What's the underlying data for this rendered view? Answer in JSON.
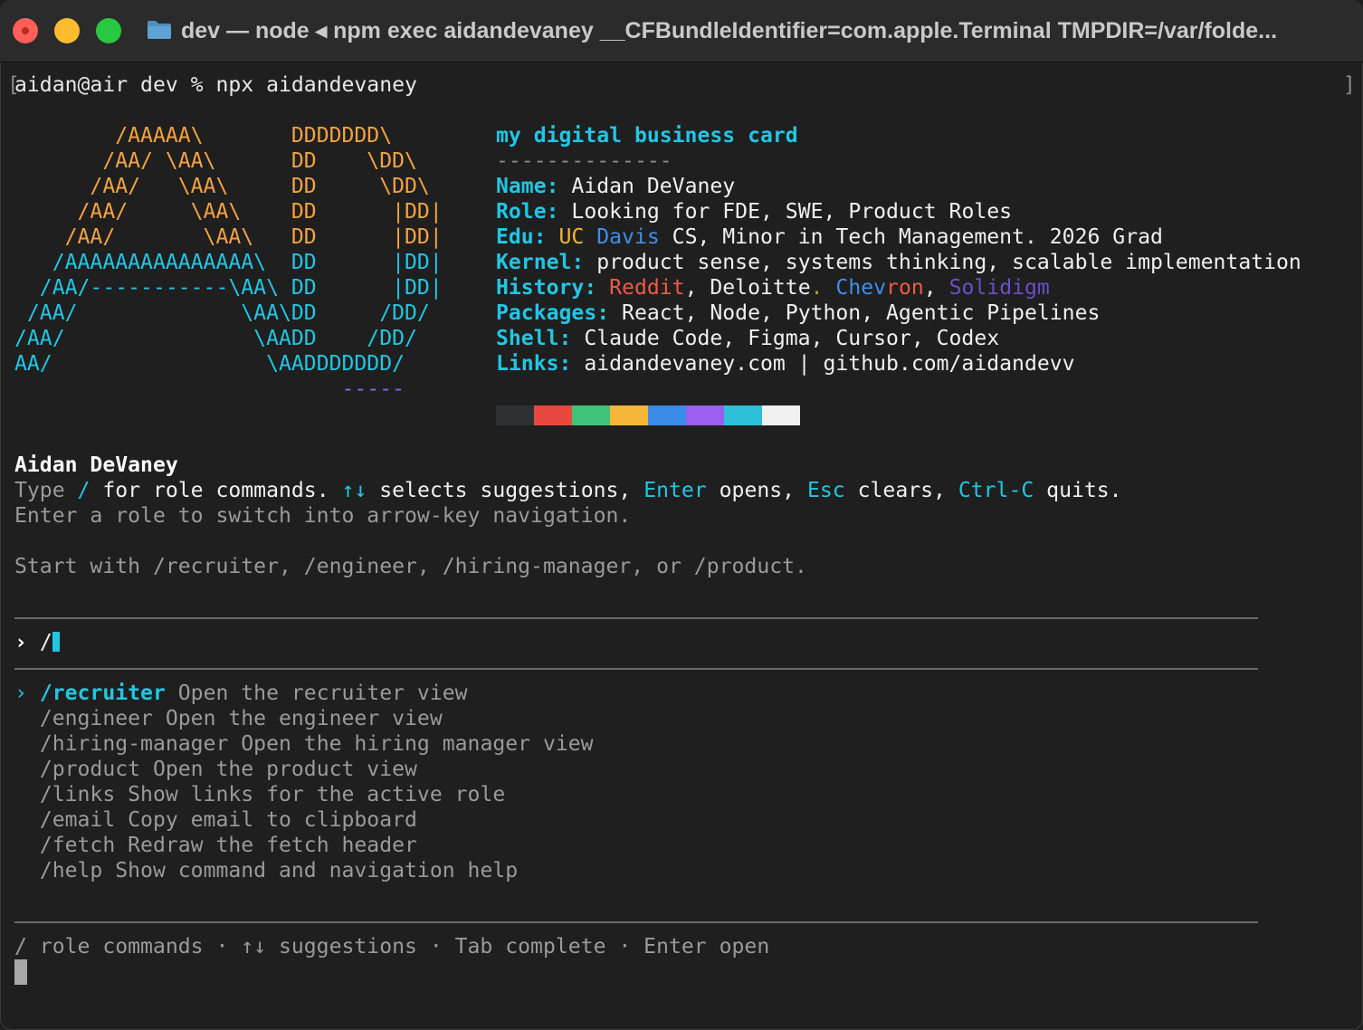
{
  "window": {
    "title": "dev — node ◂ npm exec aidandevaney __CFBundleIdentifier=com.apple.Terminal TMPDIR=/var/folde..."
  },
  "command_line": {
    "prompt": "aidan@air dev % ",
    "command": "npx aidandevaney",
    "bracket_left": "[",
    "bracket_right": "]"
  },
  "ascii_art": {
    "rows": [
      {
        "a": "        /AAAAA\\       ",
        "d": "DDDDDDD\\"
      },
      {
        "a": "       /AA/ \\AA\\      ",
        "d": "DD    \\DD\\"
      },
      {
        "a": "      /AA/   \\AA\\     ",
        "d": "DD     \\DD\\"
      },
      {
        "a": "     /AA/     \\AA\\    ",
        "d": "DD      |DD|"
      },
      {
        "a": "    /AA/       \\AA\\   ",
        "d": "DD      |DD|"
      },
      {
        "a": "   /AAAAAAAAAAAAAAA\\  ",
        "d": "DD      |DD|"
      },
      {
        "a": "  /AA/-----------\\AA\\ ",
        "d": "DD      |DD|"
      },
      {
        "a": " /AA/             \\AA\\",
        "d": "DD     /DD/"
      },
      {
        "a": "/AA/               \\AA",
        "d": "DD    /DD/"
      },
      {
        "a": "AA/                 \\A",
        "d": "ADDDDDDD/"
      }
    ],
    "underline": "                          -----"
  },
  "card": {
    "title": "my digital business card",
    "separator": "--------------",
    "name_key": "Name:",
    "name_val": " Aidan DeVaney",
    "role_key": "Role:",
    "role_val": " Looking for FDE, SWE, Product Roles",
    "edu_key": "Edu:",
    "edu_uc": " UC",
    "edu_davis": " Davis",
    "edu_rest": " CS, Minor in Tech Management. 2026 Grad",
    "kernel_key": "Kernel:",
    "kernel_val": " product sense, systems thinking, scalable implementation",
    "history_key": "History:",
    "history_reddit": " Reddit",
    "history_comma1": ", Deloitte",
    "history_dot": ".",
    "history_chev1": " Chev",
    "history_chev2": "ron",
    "history_comma2": ", ",
    "history_solid": "Solidigm",
    "packages_key": "Packages:",
    "packages_val": " React, Node, Python, Agentic Pipelines",
    "shell_key": "Shell:",
    "shell_val": " Claude Code, Figma, Cursor, Codex",
    "links_key": "Links:",
    "links_val": " aidandevaney.com | github.com/aidandevv"
  },
  "swatch_colors": [
    "#2e3133",
    "#2e3133",
    "#2e3133",
    "#e8493e",
    "#e8493e",
    "#e8493e",
    "#3fc27a",
    "#3fc27a",
    "#3fc27a",
    "#f5b63a",
    "#f5b63a",
    "#f5b63a",
    "#3a8be8",
    "#3a8be8",
    "#3a8be8",
    "#9a5ff0",
    "#9a5ff0",
    "#9a5ff0",
    "#2ec0d8",
    "#2ec0d8",
    "#2ec0d8",
    "#f0f0f0",
    "#f0f0f0",
    "#f0f0f0"
  ],
  "intro": {
    "name": "Aidan DeVaney",
    "type_word": "Type ",
    "slash": "/",
    "for_role": " for role commands. ",
    "arrows": "↑↓",
    "selects": " selects suggestions, ",
    "enter": "Enter",
    "opens": " opens, ",
    "esc": "Esc",
    "clears": " clears, ",
    "ctrlc": "Ctrl-C",
    "quits": " quits.",
    "line2": "Enter a role to switch into arrow-key navigation.",
    "line3": "Start with /recruiter, /engineer, /hiring-manager, or /product."
  },
  "input": {
    "prompt": "› ",
    "value": "/"
  },
  "suggestions": {
    "selected_marker": "› ",
    "items": [
      {
        "cmd": "/recruiter",
        "desc": " Open the recruiter view"
      },
      {
        "cmd": "/engineer",
        "desc": " Open the engineer view"
      },
      {
        "cmd": "/hiring-manager",
        "desc": " Open the hiring manager view"
      },
      {
        "cmd": "/product",
        "desc": " Open the product view"
      },
      {
        "cmd": "/links",
        "desc": " Show links for the active role"
      },
      {
        "cmd": "/email",
        "desc": " Copy email to clipboard"
      },
      {
        "cmd": "/fetch",
        "desc": " Redraw the fetch header"
      },
      {
        "cmd": "/help",
        "desc": " Show command and navigation help"
      }
    ]
  },
  "footer": {
    "hint": "/ role commands · ↑↓ suggestions · Tab complete · Enter open"
  }
}
